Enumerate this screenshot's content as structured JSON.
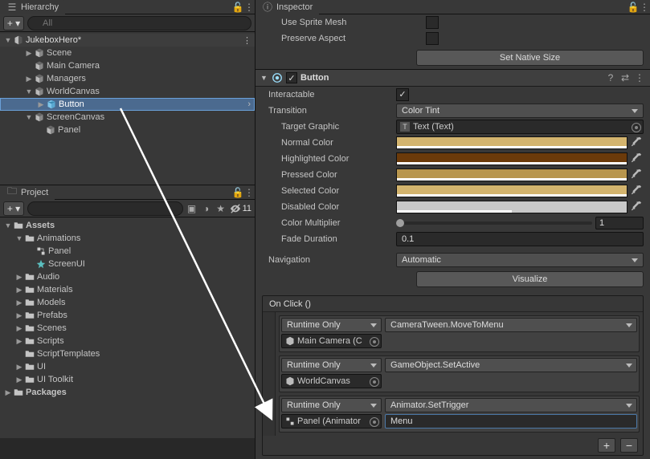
{
  "hierarchy": {
    "title": "Hierarchy",
    "search_placeholder": "All",
    "scene": "JukeboxHero*",
    "items": [
      {
        "name": "Scene",
        "depth": 1,
        "expand": "▶"
      },
      {
        "name": "Main Camera",
        "depth": 1,
        "expand": ""
      },
      {
        "name": "Managers",
        "depth": 1,
        "expand": "▶"
      },
      {
        "name": "WorldCanvas",
        "depth": 1,
        "expand": "▼"
      },
      {
        "name": "Button",
        "depth": 2,
        "expand": "▶",
        "selected": true
      },
      {
        "name": "ScreenCanvas",
        "depth": 1,
        "expand": "▼"
      },
      {
        "name": "Panel",
        "depth": 2,
        "expand": ""
      }
    ]
  },
  "project": {
    "title": "Project",
    "search_placeholder": "",
    "view_count": "11",
    "root": "Assets",
    "folders": [
      {
        "name": "Animations",
        "depth": 1,
        "expand": "▼",
        "type": "folder"
      },
      {
        "name": "Panel",
        "depth": 2,
        "expand": "",
        "type": "anim-controller"
      },
      {
        "name": "ScreenUI",
        "depth": 2,
        "expand": "",
        "type": "anim-clip"
      },
      {
        "name": "Audio",
        "depth": 1,
        "expand": "▶",
        "type": "folder"
      },
      {
        "name": "Materials",
        "depth": 1,
        "expand": "▶",
        "type": "folder"
      },
      {
        "name": "Models",
        "depth": 1,
        "expand": "▶",
        "type": "folder"
      },
      {
        "name": "Prefabs",
        "depth": 1,
        "expand": "▶",
        "type": "folder"
      },
      {
        "name": "Scenes",
        "depth": 1,
        "expand": "▶",
        "type": "folder"
      },
      {
        "name": "Scripts",
        "depth": 1,
        "expand": "▶",
        "type": "folder"
      },
      {
        "name": "ScriptTemplates",
        "depth": 1,
        "expand": "",
        "type": "folder"
      },
      {
        "name": "UI",
        "depth": 1,
        "expand": "▶",
        "type": "folder"
      },
      {
        "name": "UI Toolkit",
        "depth": 1,
        "expand": "▶",
        "type": "folder"
      }
    ],
    "packages": "Packages"
  },
  "inspector": {
    "title": "Inspector",
    "image": {
      "use_sprite_mesh": "Use Sprite Mesh",
      "preserve_aspect": "Preserve Aspect",
      "set_native_size": "Set Native Size"
    },
    "button": {
      "component_name": "Button",
      "interactable": "Interactable",
      "transition": {
        "label": "Transition",
        "value": "Color Tint"
      },
      "target_graphic": {
        "label": "Target Graphic",
        "value": "Text (Text)"
      },
      "colors": {
        "normal": {
          "label": "Normal Color",
          "hex": "#d3b46e"
        },
        "highlighted": {
          "label": "Highlighted Color",
          "hex": "#6b3a0a"
        },
        "pressed": {
          "label": "Pressed Color",
          "hex": "#b8964e"
        },
        "selected": {
          "label": "Selected Color",
          "hex": "#d3b46e"
        },
        "disabled": {
          "label": "Disabled Color",
          "hex": "#c8c8c8",
          "alpha": 0.5
        }
      },
      "color_multiplier": {
        "label": "Color Multiplier",
        "value": "1"
      },
      "fade_duration": {
        "label": "Fade Duration",
        "value": "0.1"
      },
      "navigation": {
        "label": "Navigation",
        "value": "Automatic"
      },
      "visualize": "Visualize",
      "onclick": {
        "header": "On Click ()",
        "entries": [
          {
            "callstate": "Runtime Only",
            "target": "Main Camera (C",
            "function": "CameraTween.MoveToMenu",
            "arg": "",
            "target_icon": "gameobject"
          },
          {
            "callstate": "Runtime Only",
            "target": "WorldCanvas",
            "function": "GameObject.SetActive",
            "arg": "",
            "target_icon": "gameobject"
          },
          {
            "callstate": "Runtime Only",
            "target": "Panel (Animator",
            "function": "Animator.SetTrigger",
            "arg": "Menu",
            "target_icon": "animator",
            "arg_active": true
          }
        ]
      }
    }
  }
}
